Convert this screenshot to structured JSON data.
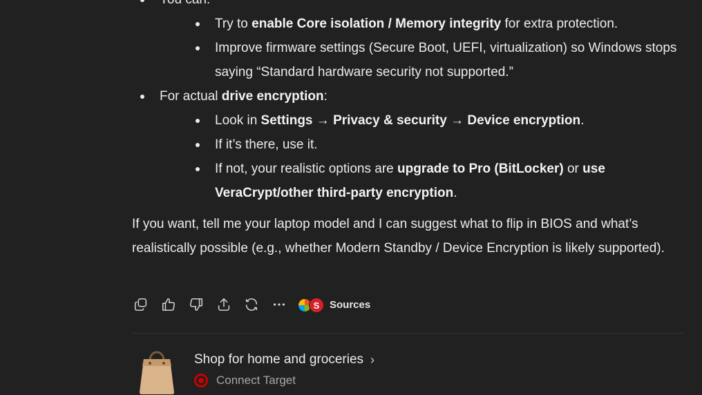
{
  "message": {
    "top_item": "You can:",
    "top_sub": [
      {
        "pre": "Try to ",
        "bold": "enable Core isolation / Memory integrity",
        "post": " for extra protection."
      },
      {
        "text": "Improve firmware settings (Secure Boot, UEFI, virtualization) so Windows stops saying “Standard hardware security not supported.”"
      }
    ],
    "drive": {
      "pre": "For actual ",
      "bold": "drive encryption",
      "post": ":",
      "sub": [
        {
          "pre": "Look in ",
          "b1": "Settings",
          "a1": " → ",
          "b2": "Privacy & security",
          "a2": " → ",
          "b3": "Device encryption",
          "post": "."
        },
        {
          "text": "If it’s there, use it."
        },
        {
          "pre": "If not, your realistic options are ",
          "b1": "upgrade to Pro (BitLocker)",
          "mid": " or ",
          "b2": "use VeraCrypt/other third-party encryption",
          "post": "."
        }
      ]
    },
    "closing": "If you want, tell me your laptop model and I can suggest what to flip in BIOS and what’s realistically possible (e.g., whether Modern Standby / Device Encryption is likely supported)."
  },
  "actions": {
    "icons": [
      "copy-icon",
      "thumbs-up-icon",
      "thumbs-down-icon",
      "share-icon",
      "regenerate-icon",
      "more-icon"
    ],
    "sources_label": "Sources",
    "source_badge_letter": "S"
  },
  "suggestion": {
    "title": "Shop for home and groceries",
    "subtitle": "Connect Target",
    "icon": "shopping-bag-icon"
  },
  "colors": {
    "background": "#212121",
    "text": "#ececec",
    "target_red": "#cc0000"
  }
}
